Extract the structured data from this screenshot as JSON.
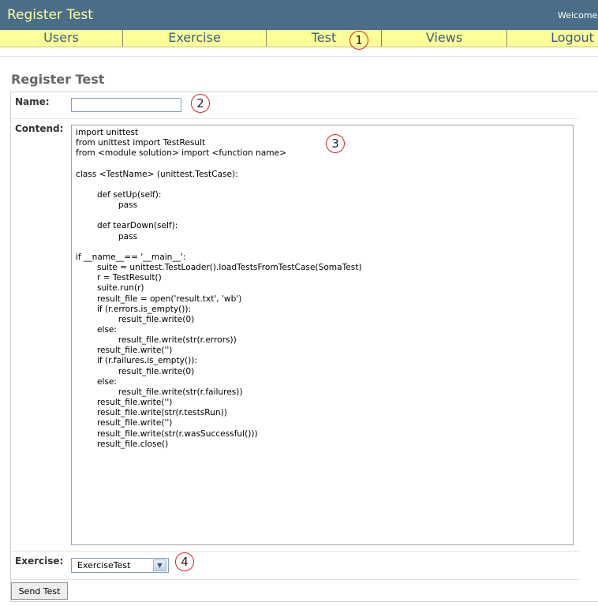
{
  "header": {
    "app_title": "Register Test",
    "welcome_text": "Welcome"
  },
  "nav": {
    "items": [
      "Users",
      "Exercise",
      "Test",
      "Views",
      "Logout"
    ]
  },
  "page": {
    "title": "Register Test"
  },
  "form": {
    "name_label": "Name:",
    "name_value": "",
    "contend_label": "Contend:",
    "contend_value": "import unittest\nfrom unittest import TestResult\nfrom <module solution> import <function name>\n\nclass <TestName> (unittest.TestCase):\n\n        def setUp(self):\n                pass\n\n        def tearDown(self):\n                pass\n\nif __name__== '__main__':\n        suite = unittest.TestLoader().loadTestsFromTestCase(SomaTest)\n        r = TestResult()\n        suite.run(r)\n        result_file = open('result.txt', 'wb')\n        if (r.errors.is_empty()):\n                result_file.write(0)\n        else:\n                result_file.write(str(r.errors))\n        result_file.write('')\n        if (r.failures.is_empty()):\n                result_file.write(0)\n        else:\n                result_file.write(str(r.failures))\n        result_file.write('')\n        result_file.write(str(r.testsRun))\n        result_file.write('')\n        result_file.write(str(r.wasSuccessful()))\n        result_file.close()",
    "exercise_label": "Exercise:",
    "exercise_selected": "ExerciseTest",
    "submit_label": "Send Test"
  },
  "callouts": [
    "1",
    "2",
    "3",
    "4"
  ],
  "icons": {
    "select_arrow": "chevron-down-icon"
  },
  "colors": {
    "topbar": "#4a6e88",
    "title_text": "#ffff99",
    "navbar": "#ffff99",
    "nav_text": "#35608a",
    "callout_border": "#e02020"
  }
}
